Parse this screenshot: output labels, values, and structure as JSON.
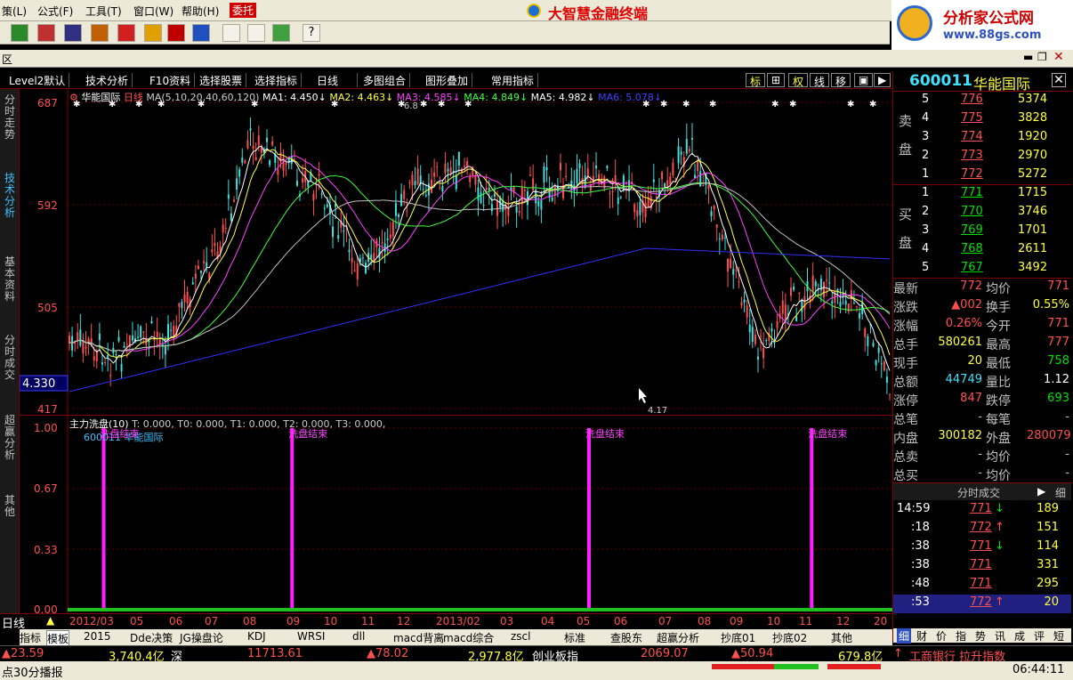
{
  "menu": {
    "items": [
      "策(L)",
      "公式(F)",
      "工具(T)",
      "窗口(W)",
      "帮助(H)",
      "委托"
    ],
    "brand": "大智慧金融终端"
  },
  "ad": {
    "title": "分析家公式网",
    "url": "www.88gs.com"
  },
  "window": {
    "label": "区"
  },
  "chartbar": {
    "tabs": [
      "Level2默认",
      "技术分析",
      "F10资料",
      "选择股票",
      "选择指标",
      "日线",
      "多图组合",
      "图形叠加",
      "常用指标"
    ],
    "right_buttons": [
      "标",
      "⊞",
      "权",
      "线",
      "移"
    ]
  },
  "left_tabs": [
    "分时走势",
    "技术分析",
    "基本资料",
    "分时成交",
    "超赢分析",
    "其他"
  ],
  "main": {
    "name": "华能国际",
    "period": "日线",
    "ma_label": "MA(5,10,20,40,60,120)",
    "ma": [
      {
        "name": "MA1:",
        "value": "4.450",
        "color": "#ffffff"
      },
      {
        "name": "MA2:",
        "value": "4.463",
        "color": "#ffff40"
      },
      {
        "name": "MA3:",
        "value": "4.585",
        "color": "#ff40ff"
      },
      {
        "name": "MA4:",
        "value": "4.849",
        "color": "#40ff40"
      },
      {
        "name": "MA5:",
        "value": "4.982",
        "color": "#ffffff"
      },
      {
        "name": "MA6:",
        "value": "5.078",
        "color": "#4040ff"
      }
    ],
    "y_labels": [
      "687",
      "592",
      "505",
      "417"
    ],
    "price_box": "4.330",
    "marks": [
      "6.8",
      "4.17"
    ]
  },
  "sub": {
    "title": "主力洗盘(10)",
    "params": "T: 0.000, T0: 0.000, T1: 0.000, T2: 0.000, T3: 0.000,",
    "stock": "600011 华能国际",
    "y_labels": [
      "1.00",
      "0.67",
      "0.33",
      "0.00"
    ],
    "event": "洗盘结束",
    "events_at": [
      0.02,
      0.27,
      0.63,
      0.9
    ]
  },
  "xaxis": {
    "labels": [
      "2012/03",
      "05",
      "06",
      "07",
      "08",
      "09",
      "10",
      "11",
      "12",
      "2013/02",
      "03",
      "04",
      "05",
      "06",
      "07",
      "08",
      "09",
      "10",
      "11",
      "12",
      "20"
    ],
    "period": "日线"
  },
  "bottom_tabs": [
    "指标",
    "模板",
    "2015",
    "Dde决策",
    "JG操盘论",
    "KDJ",
    "WRSI",
    "dll",
    "macd背离",
    "macd综合",
    "zscl",
    "标准",
    "查股东",
    "超赢分析",
    "抄底01",
    "抄底02",
    "其他"
  ],
  "quote": {
    "code": "600011",
    "name": "华能国际",
    "sell": [
      {
        "lv": "5",
        "p": "776",
        "v": "5374"
      },
      {
        "lv": "4",
        "p": "775",
        "v": "3828"
      },
      {
        "lv": "3",
        "p": "774",
        "v": "1920"
      },
      {
        "lv": "2",
        "p": "773",
        "v": "2970"
      },
      {
        "lv": "1",
        "p": "772",
        "v": "5272"
      }
    ],
    "buy": [
      {
        "lv": "1",
        "p": "771",
        "v": "1715"
      },
      {
        "lv": "2",
        "p": "770",
        "v": "3746"
      },
      {
        "lv": "3",
        "p": "769",
        "v": "1701"
      },
      {
        "lv": "4",
        "p": "768",
        "v": "2611"
      },
      {
        "lv": "5",
        "p": "767",
        "v": "3492"
      }
    ],
    "sell_label": "卖盘",
    "buy_label": "买盘",
    "stats": [
      [
        "最新",
        "772",
        "均价",
        "771"
      ],
      [
        "涨跌",
        "▲002",
        "换手",
        "0.55%"
      ],
      [
        "涨幅",
        "0.26%",
        "今开",
        "771"
      ],
      [
        "总手",
        "580261",
        "最高",
        "777"
      ],
      [
        "现手",
        "20",
        "最低",
        "758"
      ],
      [
        "总额",
        "44749",
        "量比",
        "1.12"
      ],
      [
        "涨停",
        "847",
        "跌停",
        "693"
      ],
      [
        "总笔",
        "-",
        "每笔",
        "-"
      ],
      [
        "内盘",
        "300182",
        "外盘",
        "280079"
      ],
      [
        "总卖",
        "-",
        "均价",
        "-"
      ],
      [
        "总买",
        "-",
        "均价",
        "-"
      ]
    ],
    "ticks_title": "分时成交",
    "ticks_btn": "细",
    "ticks": [
      [
        "14:59",
        "771",
        "↓",
        "189"
      ],
      [
        ":18",
        "772",
        "↑",
        "151"
      ],
      [
        ":38",
        "771",
        "↓",
        "114"
      ],
      [
        ":38",
        "771",
        "",
        "331"
      ],
      [
        ":48",
        "771",
        "",
        "295"
      ],
      [
        ":53",
        "772",
        "↑",
        "20"
      ]
    ],
    "bottom_tabs": [
      "细",
      "财",
      "价",
      "指",
      "势",
      "讯",
      "成",
      "评",
      "短"
    ]
  },
  "status": {
    "items": [
      "▲23.59",
      "3,740.4亿",
      "深",
      "11713.61",
      "▲78.02",
      "2,977.8亿",
      "创业板指",
      "2069.07",
      "▲50.94",
      "679.8亿",
      "工商银行 拉升指数"
    ],
    "footer": "点30分播报",
    "time": "06:44:11"
  }
}
